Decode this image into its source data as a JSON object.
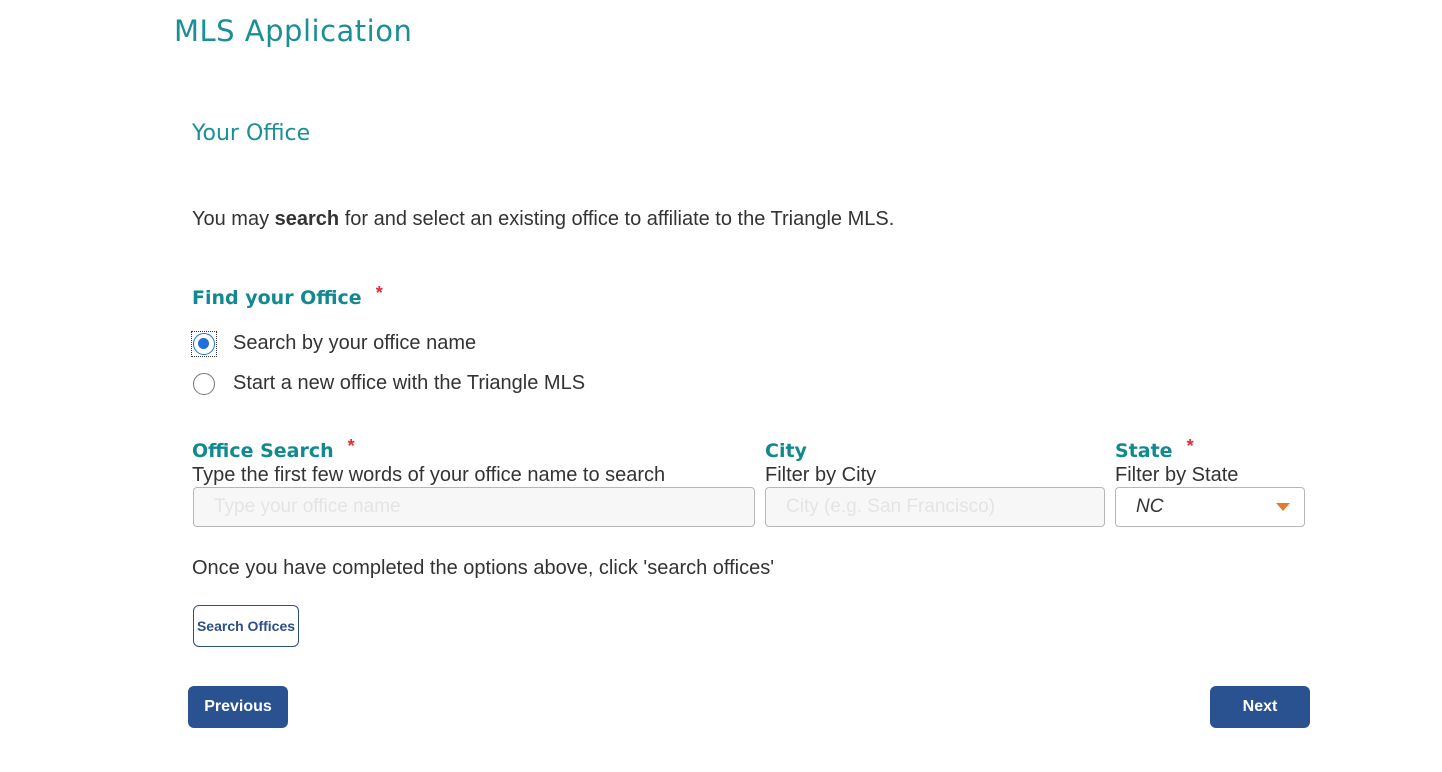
{
  "header": {
    "title": "MLS Application"
  },
  "section": {
    "title": "Your Office"
  },
  "intro": {
    "prefix": "You may ",
    "bold": "search",
    "suffix": " for and select an existing office to affiliate to the Triangle MLS."
  },
  "find_office": {
    "label": "Find your Office",
    "required_mark": "*",
    "options": [
      {
        "label": "Search by your office name",
        "checked": true
      },
      {
        "label": "Start a new office with the Triangle MLS",
        "checked": false
      }
    ]
  },
  "office_search": {
    "label": "Office Search",
    "required_mark": "*",
    "hint": "Type the first few words of your office name to search",
    "placeholder": "Type your office name",
    "value": ""
  },
  "city": {
    "label": "City",
    "hint": "Filter by City",
    "placeholder": "City (e.g. San Francisco)",
    "value": ""
  },
  "state": {
    "label": "State",
    "required_mark": "*",
    "hint": "Filter by State",
    "selected": "NC"
  },
  "instruction": "Once you have completed the options above, click 'search offices'",
  "buttons": {
    "search_offices": "Search Offices",
    "previous": "Previous",
    "next": "Next"
  },
  "colors": {
    "teal": "#1a8f95",
    "required": "#e02a35",
    "button_blue": "#2a5291",
    "caret_orange": "#e8792b",
    "radio_blue": "#1f6fde"
  }
}
